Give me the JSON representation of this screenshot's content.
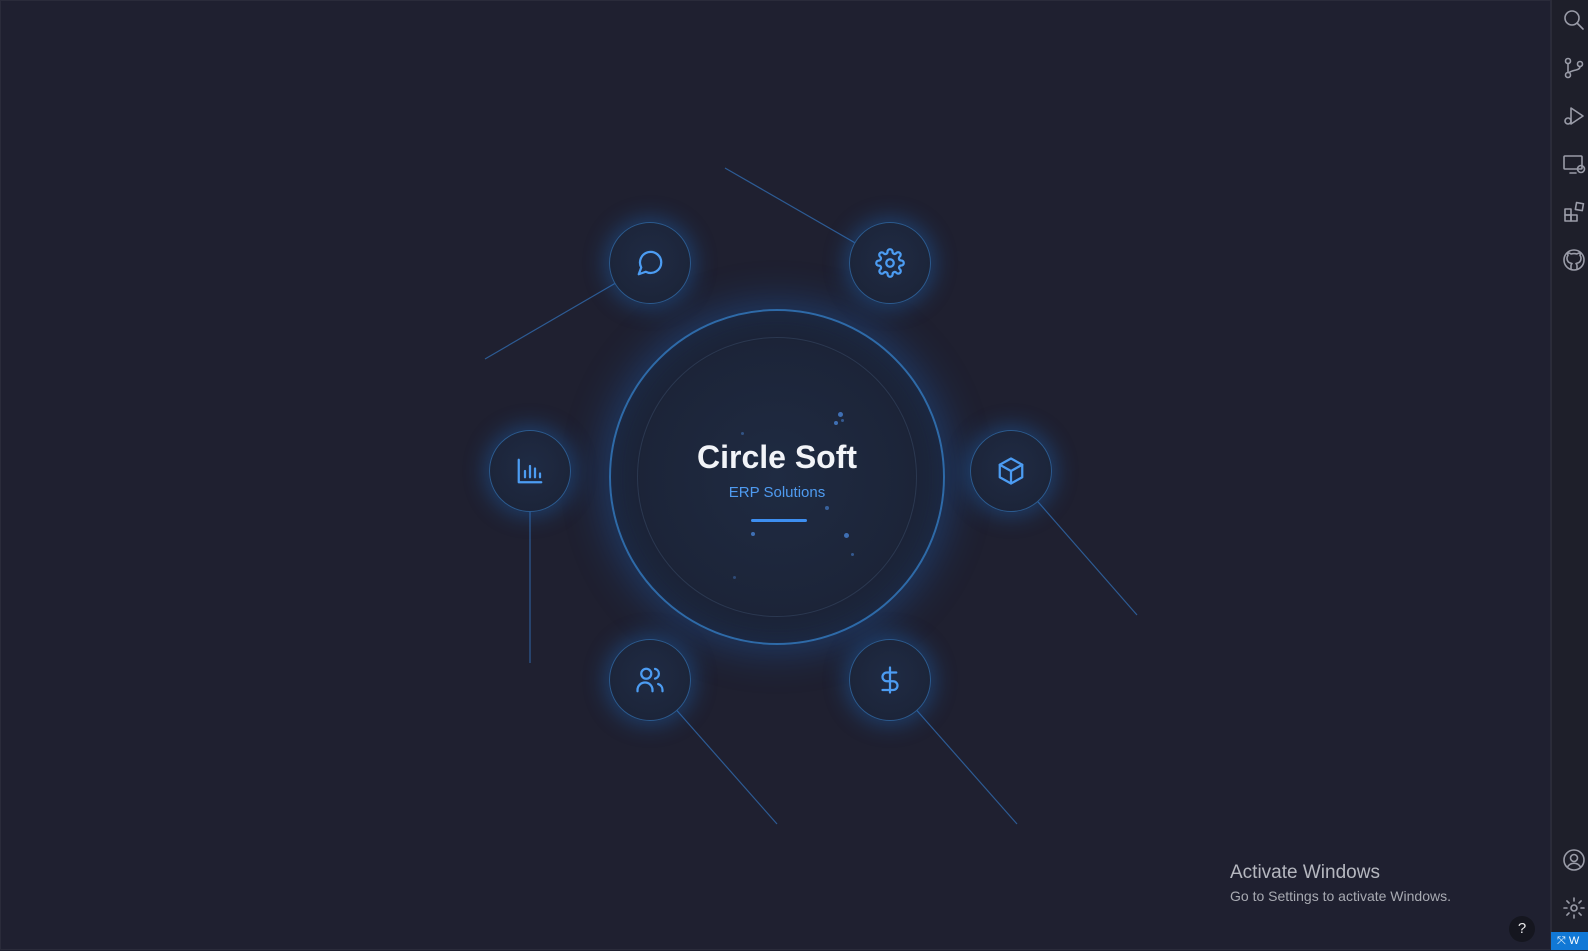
{
  "brand": {
    "title": "Circle Soft",
    "subtitle": "ERP Solutions"
  },
  "modules": [
    {
      "icon": "chat-bubble-icon"
    },
    {
      "icon": "gear-icon"
    },
    {
      "icon": "bar-chart-icon"
    },
    {
      "icon": "cube-icon"
    },
    {
      "icon": "users-icon"
    },
    {
      "icon": "dollar-icon"
    }
  ],
  "activity_bar": {
    "icons": [
      "search-icon",
      "source-control-icon",
      "run-debug-icon",
      "remote-explorer-icon",
      "extensions-icon",
      "github-icon",
      "account-icon",
      "manage-gear-icon"
    ]
  },
  "status_bar": {
    "remote_label": "W"
  },
  "watermark": {
    "title": "Activate Windows",
    "subtitle": "Go to Settings to activate Windows."
  },
  "help": {
    "label": "?"
  },
  "colors": {
    "background": "#1f2030",
    "accent": "#4c9cf2",
    "ring": "#2e6aa8"
  }
}
